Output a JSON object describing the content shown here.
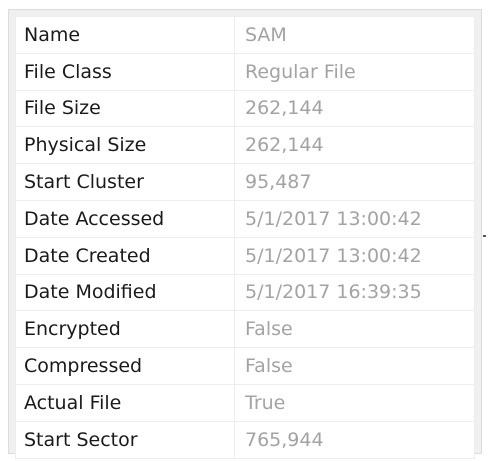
{
  "properties": [
    {
      "key": "Name",
      "value": "SAM"
    },
    {
      "key": "File Class",
      "value": "Regular File"
    },
    {
      "key": "File Size",
      "value": "262,144"
    },
    {
      "key": "Physical Size",
      "value": "262,144"
    },
    {
      "key": "Start Cluster",
      "value": "95,487"
    },
    {
      "key": "Date Accessed",
      "value": "5/1/2017 13:00:42"
    },
    {
      "key": "Date Created",
      "value": "5/1/2017 13:00:42"
    },
    {
      "key": "Date Modified",
      "value": "5/1/2017 16:39:35"
    },
    {
      "key": "Encrypted",
      "value": "False"
    },
    {
      "key": "Compressed",
      "value": "False"
    },
    {
      "key": "Actual File",
      "value": "True"
    },
    {
      "key": "Start Sector",
      "value": "765,944"
    }
  ]
}
